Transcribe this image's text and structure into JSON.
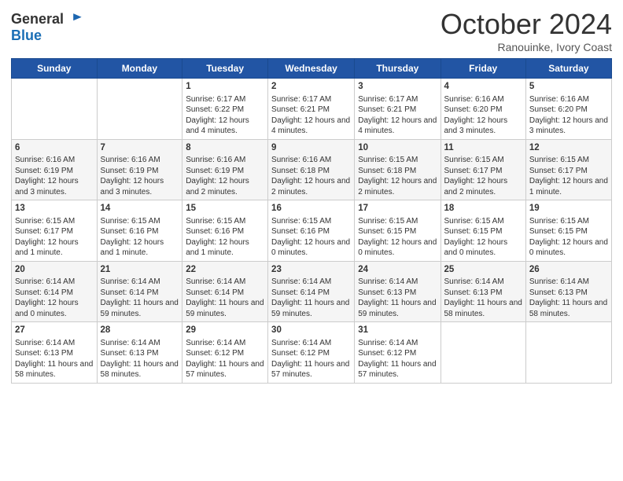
{
  "header": {
    "logo_line1": "General",
    "logo_line2": "Blue",
    "month": "October 2024",
    "location": "Ranouinke, Ivory Coast"
  },
  "days_of_week": [
    "Sunday",
    "Monday",
    "Tuesday",
    "Wednesday",
    "Thursday",
    "Friday",
    "Saturday"
  ],
  "weeks": [
    [
      {
        "day": "",
        "info": ""
      },
      {
        "day": "",
        "info": ""
      },
      {
        "day": "1",
        "info": "Sunrise: 6:17 AM\nSunset: 6:22 PM\nDaylight: 12 hours and 4 minutes."
      },
      {
        "day": "2",
        "info": "Sunrise: 6:17 AM\nSunset: 6:21 PM\nDaylight: 12 hours and 4 minutes."
      },
      {
        "day": "3",
        "info": "Sunrise: 6:17 AM\nSunset: 6:21 PM\nDaylight: 12 hours and 4 minutes."
      },
      {
        "day": "4",
        "info": "Sunrise: 6:16 AM\nSunset: 6:20 PM\nDaylight: 12 hours and 3 minutes."
      },
      {
        "day": "5",
        "info": "Sunrise: 6:16 AM\nSunset: 6:20 PM\nDaylight: 12 hours and 3 minutes."
      }
    ],
    [
      {
        "day": "6",
        "info": "Sunrise: 6:16 AM\nSunset: 6:19 PM\nDaylight: 12 hours and 3 minutes."
      },
      {
        "day": "7",
        "info": "Sunrise: 6:16 AM\nSunset: 6:19 PM\nDaylight: 12 hours and 3 minutes."
      },
      {
        "day": "8",
        "info": "Sunrise: 6:16 AM\nSunset: 6:19 PM\nDaylight: 12 hours and 2 minutes."
      },
      {
        "day": "9",
        "info": "Sunrise: 6:16 AM\nSunset: 6:18 PM\nDaylight: 12 hours and 2 minutes."
      },
      {
        "day": "10",
        "info": "Sunrise: 6:15 AM\nSunset: 6:18 PM\nDaylight: 12 hours and 2 minutes."
      },
      {
        "day": "11",
        "info": "Sunrise: 6:15 AM\nSunset: 6:17 PM\nDaylight: 12 hours and 2 minutes."
      },
      {
        "day": "12",
        "info": "Sunrise: 6:15 AM\nSunset: 6:17 PM\nDaylight: 12 hours and 1 minute."
      }
    ],
    [
      {
        "day": "13",
        "info": "Sunrise: 6:15 AM\nSunset: 6:17 PM\nDaylight: 12 hours and 1 minute."
      },
      {
        "day": "14",
        "info": "Sunrise: 6:15 AM\nSunset: 6:16 PM\nDaylight: 12 hours and 1 minute."
      },
      {
        "day": "15",
        "info": "Sunrise: 6:15 AM\nSunset: 6:16 PM\nDaylight: 12 hours and 1 minute."
      },
      {
        "day": "16",
        "info": "Sunrise: 6:15 AM\nSunset: 6:16 PM\nDaylight: 12 hours and 0 minutes."
      },
      {
        "day": "17",
        "info": "Sunrise: 6:15 AM\nSunset: 6:15 PM\nDaylight: 12 hours and 0 minutes."
      },
      {
        "day": "18",
        "info": "Sunrise: 6:15 AM\nSunset: 6:15 PM\nDaylight: 12 hours and 0 minutes."
      },
      {
        "day": "19",
        "info": "Sunrise: 6:15 AM\nSunset: 6:15 PM\nDaylight: 12 hours and 0 minutes."
      }
    ],
    [
      {
        "day": "20",
        "info": "Sunrise: 6:14 AM\nSunset: 6:14 PM\nDaylight: 12 hours and 0 minutes."
      },
      {
        "day": "21",
        "info": "Sunrise: 6:14 AM\nSunset: 6:14 PM\nDaylight: 11 hours and 59 minutes."
      },
      {
        "day": "22",
        "info": "Sunrise: 6:14 AM\nSunset: 6:14 PM\nDaylight: 11 hours and 59 minutes."
      },
      {
        "day": "23",
        "info": "Sunrise: 6:14 AM\nSunset: 6:14 PM\nDaylight: 11 hours and 59 minutes."
      },
      {
        "day": "24",
        "info": "Sunrise: 6:14 AM\nSunset: 6:13 PM\nDaylight: 11 hours and 59 minutes."
      },
      {
        "day": "25",
        "info": "Sunrise: 6:14 AM\nSunset: 6:13 PM\nDaylight: 11 hours and 58 minutes."
      },
      {
        "day": "26",
        "info": "Sunrise: 6:14 AM\nSunset: 6:13 PM\nDaylight: 11 hours and 58 minutes."
      }
    ],
    [
      {
        "day": "27",
        "info": "Sunrise: 6:14 AM\nSunset: 6:13 PM\nDaylight: 11 hours and 58 minutes."
      },
      {
        "day": "28",
        "info": "Sunrise: 6:14 AM\nSunset: 6:13 PM\nDaylight: 11 hours and 58 minutes."
      },
      {
        "day": "29",
        "info": "Sunrise: 6:14 AM\nSunset: 6:12 PM\nDaylight: 11 hours and 57 minutes."
      },
      {
        "day": "30",
        "info": "Sunrise: 6:14 AM\nSunset: 6:12 PM\nDaylight: 11 hours and 57 minutes."
      },
      {
        "day": "31",
        "info": "Sunrise: 6:14 AM\nSunset: 6:12 PM\nDaylight: 11 hours and 57 minutes."
      },
      {
        "day": "",
        "info": ""
      },
      {
        "day": "",
        "info": ""
      }
    ]
  ]
}
